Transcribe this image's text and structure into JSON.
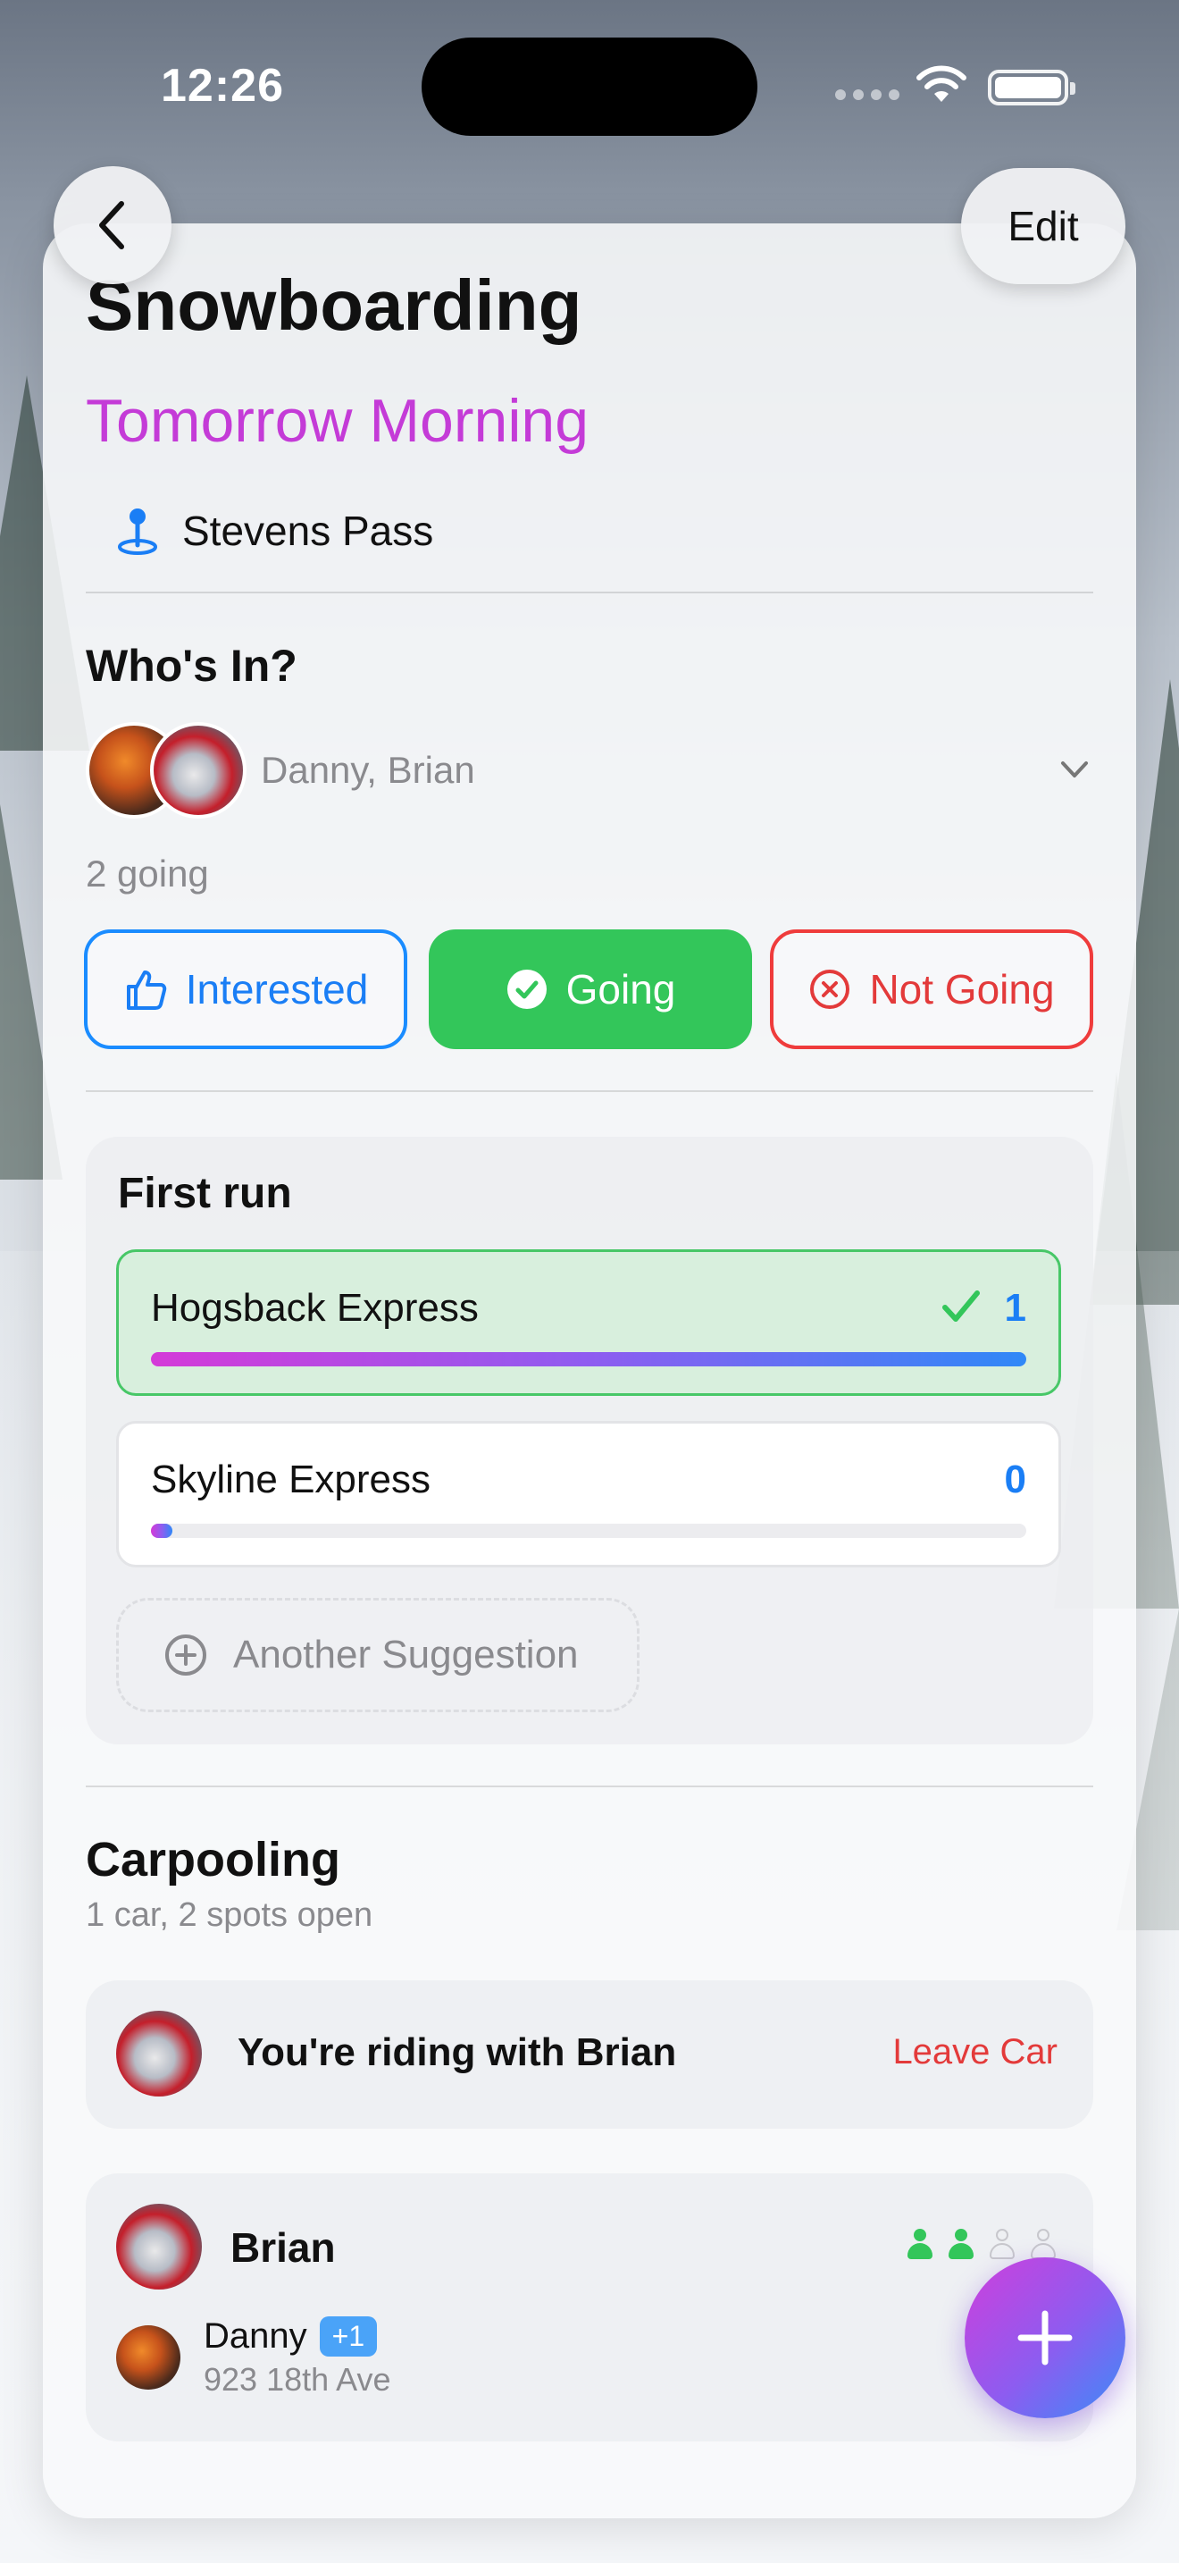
{
  "status_bar": {
    "time": "12:26"
  },
  "nav": {
    "edit_label": "Edit"
  },
  "event": {
    "title": "Snowboarding",
    "when": "Tomorrow Morning",
    "location": "Stevens Pass"
  },
  "attendance": {
    "heading": "Who's In?",
    "names": "Danny, Brian",
    "count_text": "2 going",
    "buttons": {
      "interested": "Interested",
      "going": "Going",
      "not_going": "Not Going"
    }
  },
  "poll": {
    "title": "First run",
    "options": [
      {
        "label": "Hogsback Express",
        "votes": "1",
        "fraction": 1.0,
        "selected": true
      },
      {
        "label": "Skyline Express",
        "votes": "0",
        "fraction": 0.0,
        "selected": false
      }
    ],
    "add_label": "Another Suggestion"
  },
  "carpool": {
    "title": "Carpooling",
    "summary": "1 car, 2 spots open",
    "riding_text": "You're riding with Brian",
    "leave_label": "Leave Car",
    "car": {
      "driver": "Brian",
      "seats_filled": 2,
      "seats_total": 4,
      "passenger": {
        "name": "Danny",
        "badge": "+1",
        "address": "923 18th Ave"
      }
    }
  },
  "colors": {
    "accent_purple": "#c43bd7",
    "blue": "#1a7ef5",
    "green": "#33c65a",
    "red": "#e33a3a"
  },
  "icons": {
    "back": "chevron-left-icon",
    "location": "map-pin-icon",
    "expand": "chevron-down-icon",
    "interested": "thumbs-up-icon",
    "going": "check-circle-icon",
    "not_going": "x-circle-icon",
    "vote": "checkmark-icon",
    "add_suggestion": "plus-circle-icon",
    "seat": "person-icon",
    "fab": "plus-icon"
  }
}
